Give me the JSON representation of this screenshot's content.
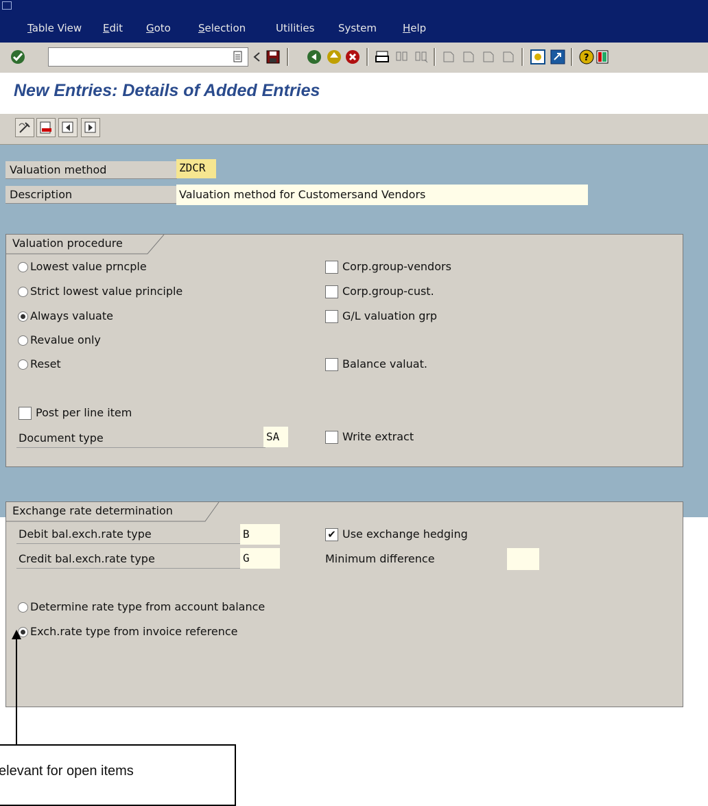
{
  "menubar": {
    "items": [
      {
        "label": "Table View",
        "u": "T"
      },
      {
        "label": "Edit",
        "u": "E"
      },
      {
        "label": "Goto",
        "u": "G"
      },
      {
        "label": "Selection",
        "u": "S"
      },
      {
        "label": "Utilities",
        "u": ""
      },
      {
        "label": "System",
        "u": ""
      },
      {
        "label": "Help",
        "u": "H"
      }
    ]
  },
  "toolbar": {
    "command_value": ""
  },
  "page": {
    "title": "New Entries: Details of Added Entries"
  },
  "fields": {
    "valuation_method_label": "Valuation method",
    "valuation_method_value": "ZDCR",
    "description_label": "Description",
    "description_value": "Valuation method for Customersand Vendors"
  },
  "valuation_procedure": {
    "title": "Valuation procedure",
    "radios": [
      {
        "label": "Lowest value prncple",
        "selected": false
      },
      {
        "label": "Strict lowest value principle",
        "selected": false
      },
      {
        "label": "Always valuate",
        "selected": true
      },
      {
        "label": "Revalue only",
        "selected": false
      },
      {
        "label": "Reset",
        "selected": false
      }
    ],
    "checks": [
      {
        "label": "Corp.group-vendors",
        "checked": false
      },
      {
        "label": "Corp.group-cust.",
        "checked": false
      },
      {
        "label": "G/L valuation grp",
        "checked": false
      },
      {
        "label": "Balance valuat.",
        "checked": false
      }
    ],
    "post_per_line_item": "Post per line item",
    "document_type_label": "Document type",
    "document_type_value": "SA",
    "write_extract": "Write extract"
  },
  "exchange_rate": {
    "title": "Exchange rate determination",
    "debit_label": "Debit bal.exch.rate type",
    "debit_value": "B",
    "credit_label": "Credit bal.exch.rate type",
    "credit_value": "G",
    "hedging_label": "Use exchange hedging",
    "hedging_checked": true,
    "min_diff_label": "Minimum difference",
    "min_diff_value": "",
    "radio_account": "Determine rate type from account balance",
    "radio_invoice": "Exch.rate type from invoice reference"
  },
  "callout": {
    "text": "elevant for open items"
  },
  "colors": {
    "menubar": "#0a1f6b",
    "title": "#2a4b8d",
    "work": "#96b2c4",
    "panel": "#d4d0c8",
    "field": "#fffde8"
  }
}
